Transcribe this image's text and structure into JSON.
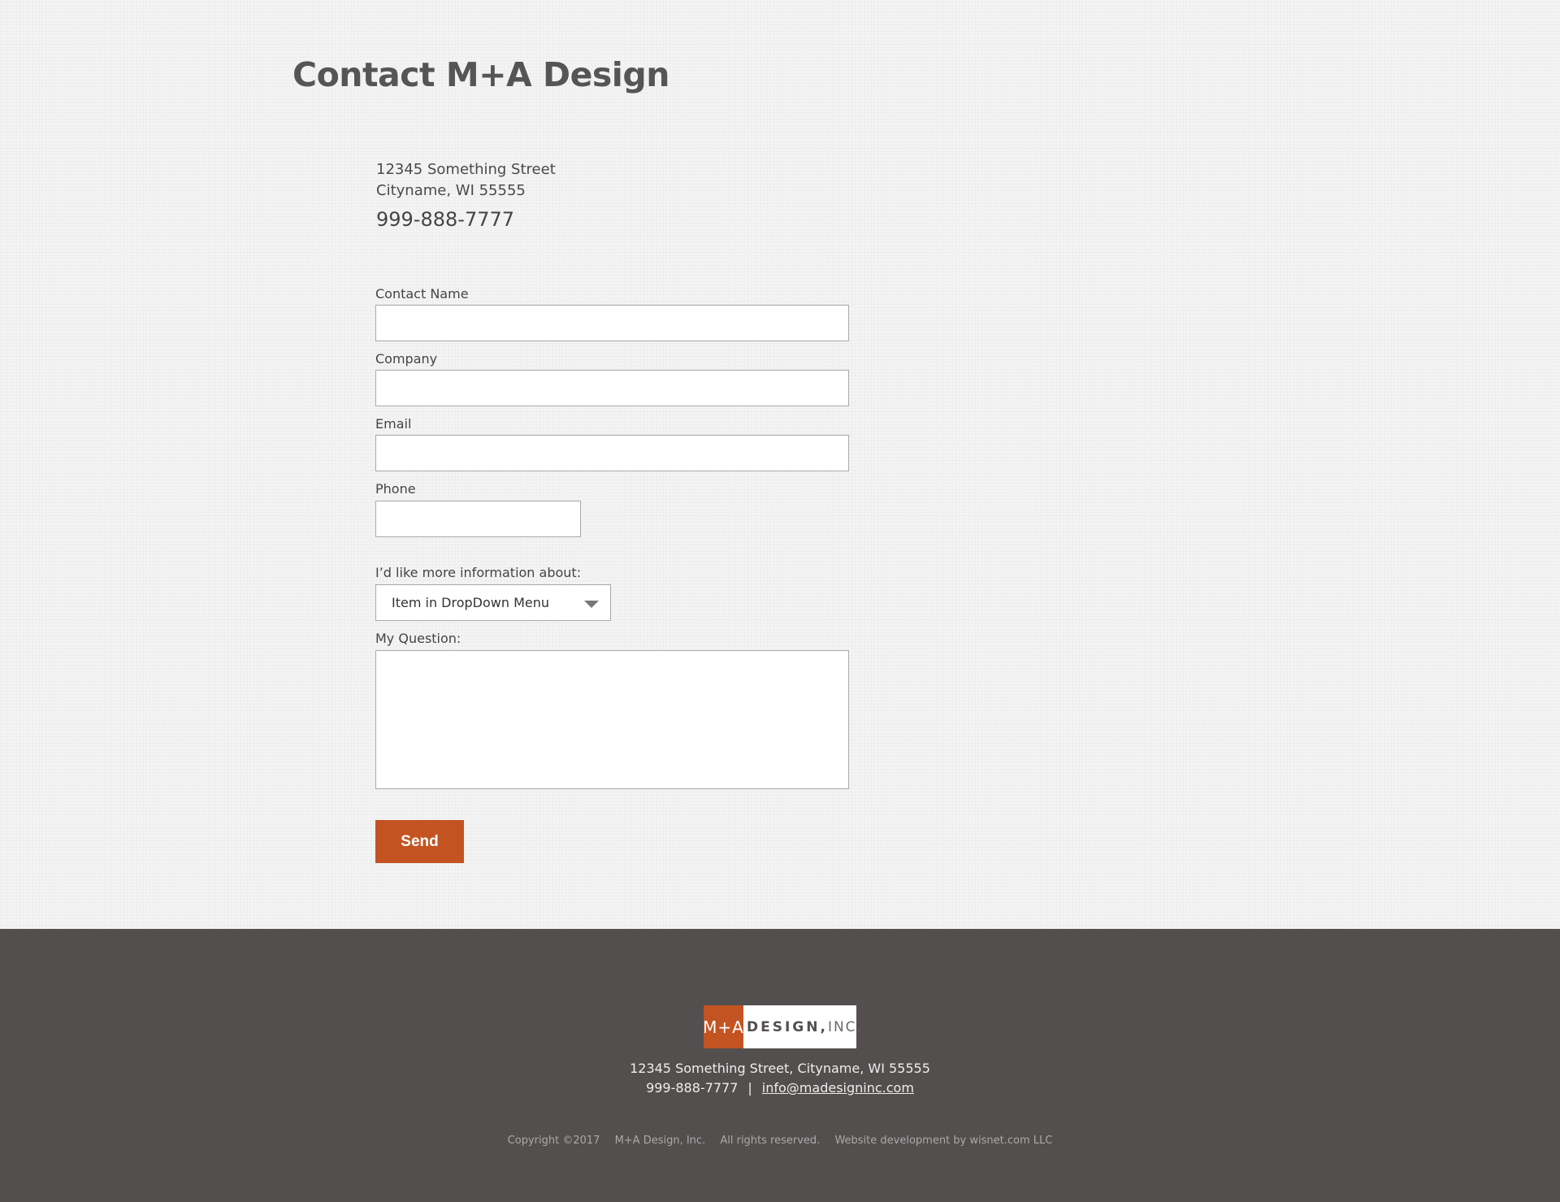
{
  "page": {
    "title": "Contact M+A Design"
  },
  "contact_info": {
    "street": "12345 Something Street",
    "city_line": "Cityname, WI 55555",
    "phone": "999-888-7777"
  },
  "form": {
    "contact_name_label": "Contact Name",
    "company_label": "Company",
    "email_label": "Email",
    "phone_label": "Phone",
    "info_label": "I’d like more information about:",
    "dropdown_selected": "Item in DropDown Menu",
    "question_label": "My Question:",
    "send_label": "Send"
  },
  "footer": {
    "logo": {
      "mark": "M+A",
      "word": "DESIGN,",
      "suffix": "INC."
    },
    "address": "12345 Something Street, Cityname, WI 55555",
    "phone": "999-888-7777",
    "separator": "|",
    "email": "info@madesigninc.com",
    "copyright": "Copyright ©2017",
    "company": "M+A Design, Inc.",
    "rights": "All rights reserved.",
    "dev_credit": "Website development by wisnet.com LLC"
  },
  "colors": {
    "accent": "#c35422",
    "footer_bg": "#524f4e",
    "page_bg": "#f4f4f4"
  },
  "icons": {
    "dropdown": "chevron-down-icon"
  }
}
